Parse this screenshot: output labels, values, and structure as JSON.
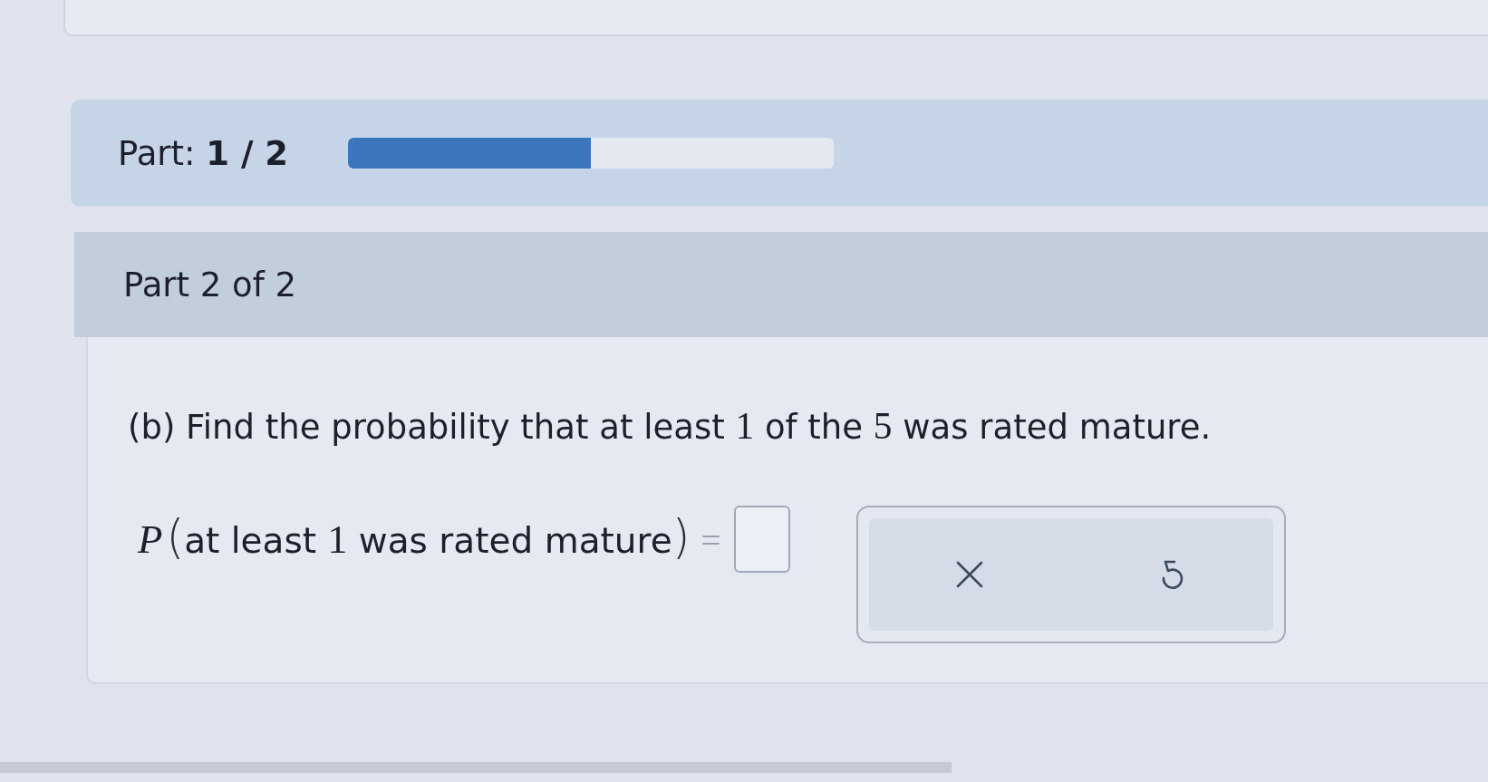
{
  "progress": {
    "text": "Part: **1 / 2**",
    "level": 0.5
  },
  "part_header": {
    "title": "Part 2 of 2"
  },
  "question": {
    "parts": [
      {
        "kind": "text",
        "text": "(b) Find the probability that at least "
      },
      {
        "kind": "math",
        "text": "1"
      },
      {
        "kind": "text",
        "text": " of the "
      },
      {
        "kind": "math",
        "text": "5"
      },
      {
        "kind": "text",
        "text": " was rated mature."
      }
    ]
  },
  "equation": {
    "parts": [
      {
        "kind": "variable",
        "text": "P"
      },
      {
        "kind": "paren",
        "text": "("
      },
      {
        "kind": "text",
        "text": "at least "
      },
      {
        "kind": "math",
        "text": "1"
      },
      {
        "kind": "text",
        "text": " was rated mature"
      },
      {
        "kind": "paren",
        "text": ")"
      },
      {
        "kind": "operator",
        "text": "="
      }
    ]
  },
  "tool_buttons": [
    {
      "kind": "clear"
    },
    {
      "kind": "undo"
    }
  ]
}
